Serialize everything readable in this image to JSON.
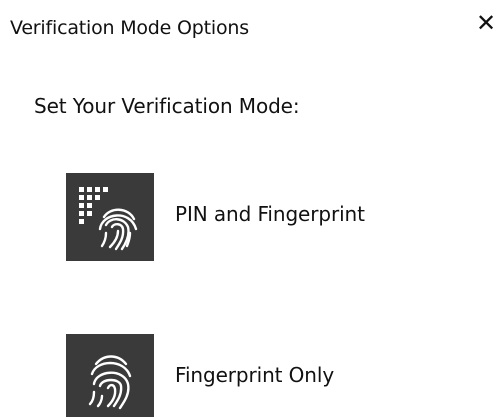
{
  "dialog": {
    "title": "Verification Mode Options",
    "close_label": "✕",
    "subtitle": "Set Your Verification Mode:"
  },
  "options": [
    {
      "label": "PIN and Fingerprint",
      "icon": "pin-fingerprint-icon"
    },
    {
      "label": "Fingerprint Only",
      "icon": "fingerprint-icon"
    }
  ],
  "colors": {
    "tile_background": "#3a3a3a",
    "icon_foreground": "#ffffff"
  }
}
